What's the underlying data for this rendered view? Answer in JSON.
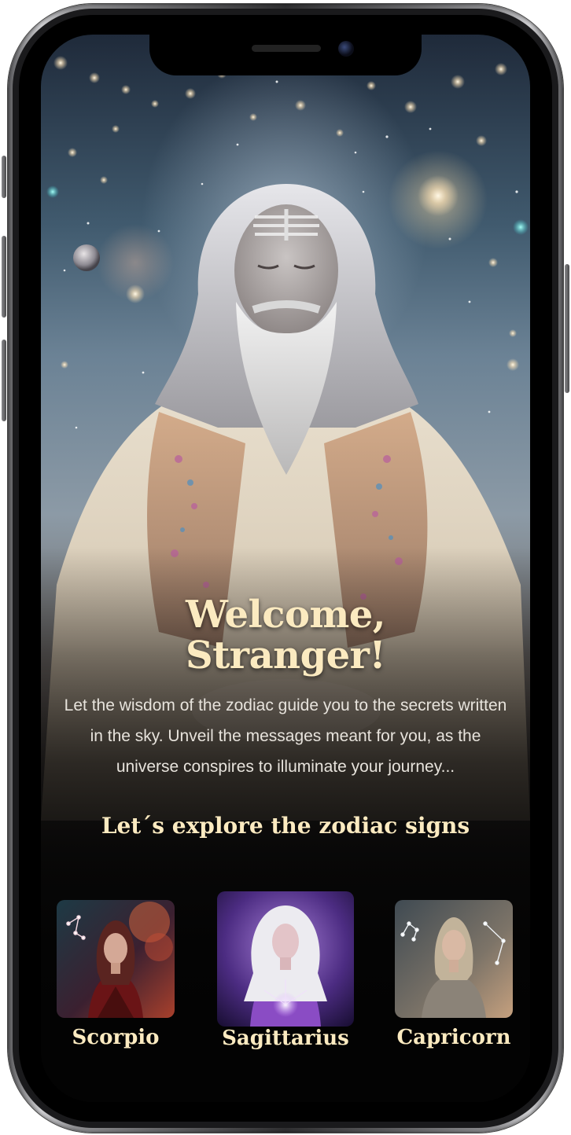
{
  "welcome": {
    "line1": "Welcome,",
    "line2": "Stranger!"
  },
  "intro_text": "Let the wisdom of the zodiac guide you to the secrets written in the sky. Unveil the messages meant for you, as the universe conspires to illuminate your journey...",
  "explore_heading": "Let´s explore the zodiac signs",
  "signs": [
    {
      "name": "Scorpio"
    },
    {
      "name": "Sagittarius"
    },
    {
      "name": "Capricorn"
    }
  ],
  "colors": {
    "heading": "#fbeac0",
    "body_text": "#e7e3dc",
    "background_bottom": "#030303"
  }
}
